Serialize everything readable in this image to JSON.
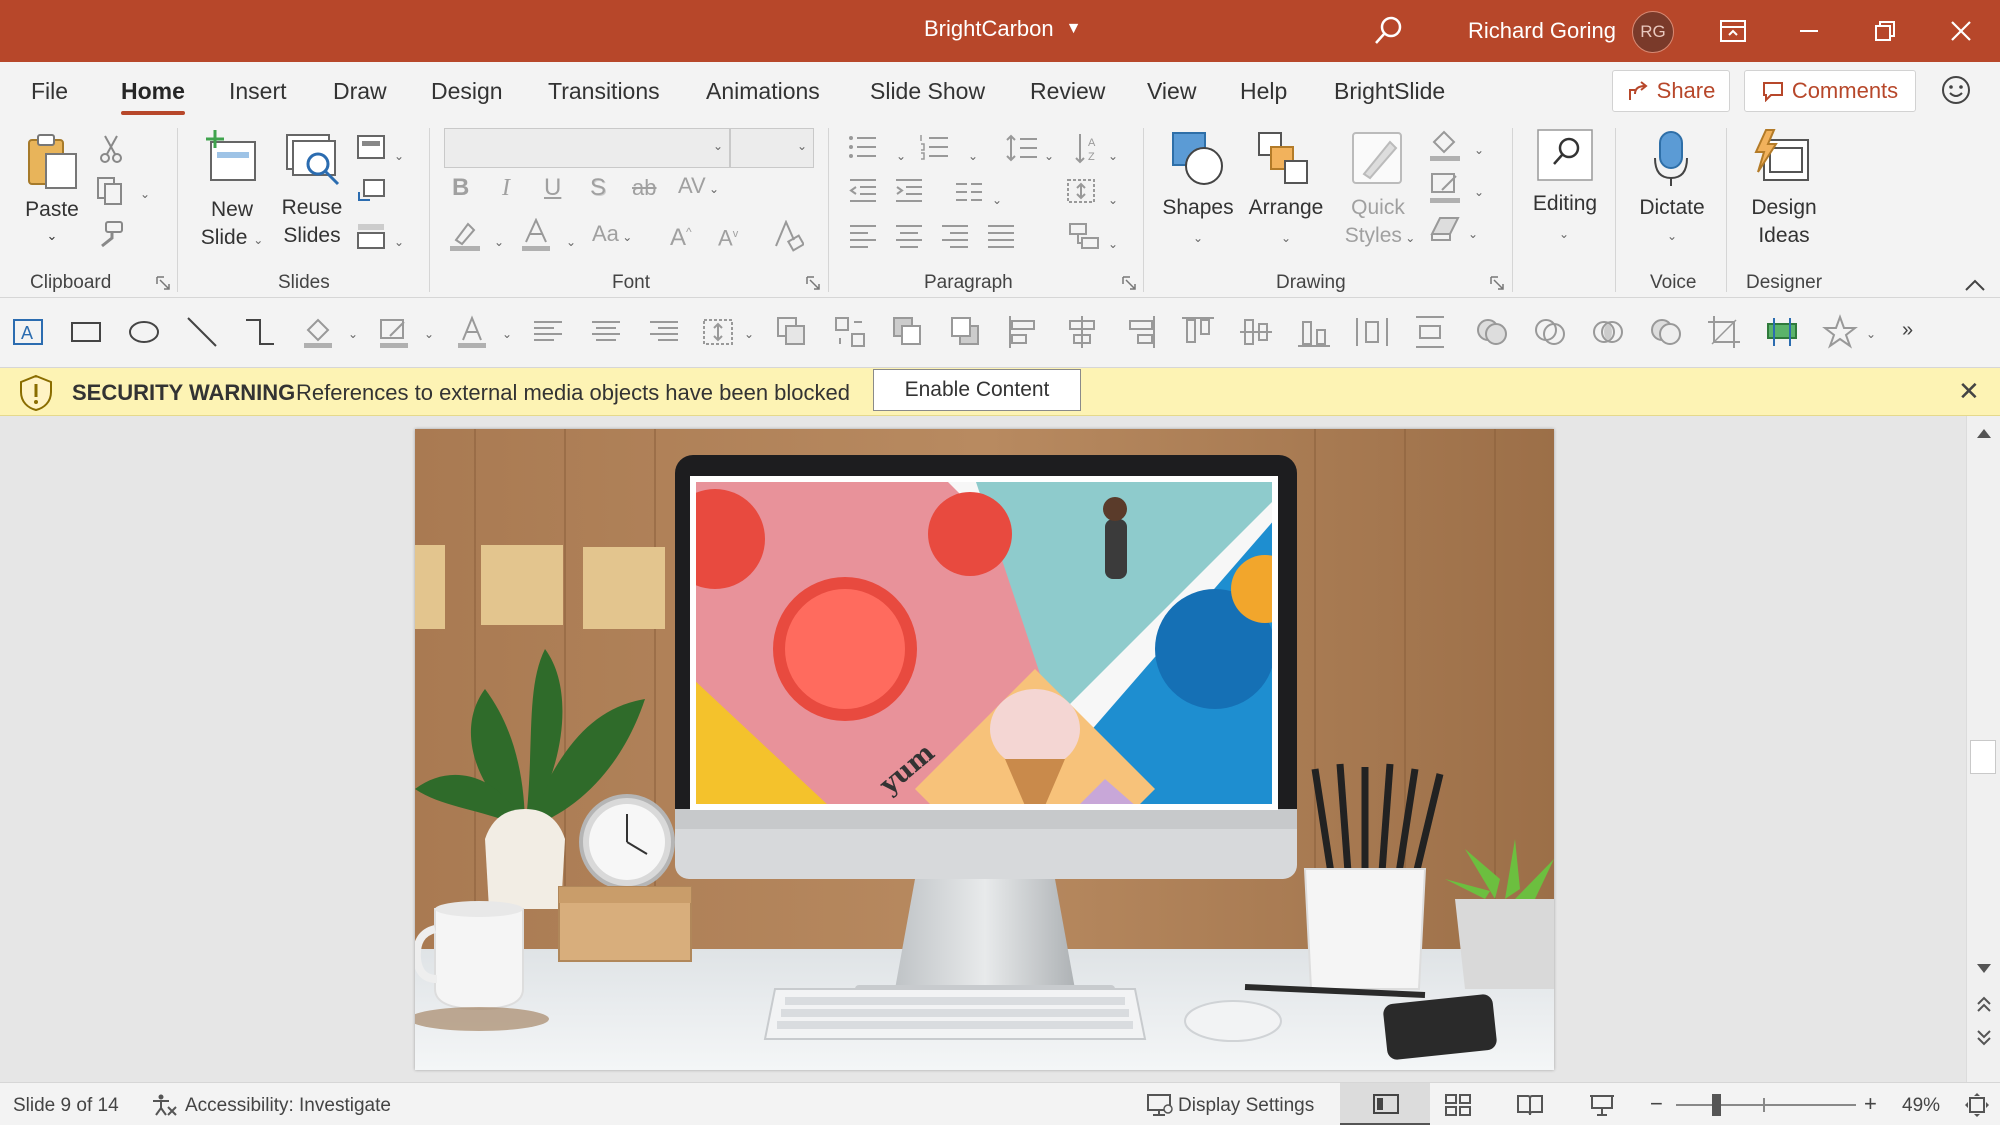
{
  "app": {
    "doc_title": "BrightCarbon",
    "user_name": "Richard Goring",
    "user_initials": "RG"
  },
  "tabs": [
    "File",
    "Home",
    "Insert",
    "Draw",
    "Design",
    "Transitions",
    "Animations",
    "Slide Show",
    "Review",
    "View",
    "Help",
    "BrightSlide"
  ],
  "actions": {
    "share": "Share",
    "comments": "Comments"
  },
  "ribbon": {
    "clipboard": {
      "label": "Clipboard",
      "paste": "Paste"
    },
    "slides": {
      "label": "Slides",
      "new_slide_1": "New",
      "new_slide_2": "Slide",
      "reuse_1": "Reuse",
      "reuse_2": "Slides"
    },
    "font": {
      "label": "Font",
      "bold": "B",
      "italic": "I",
      "underline": "U",
      "shadow": "S",
      "strike": "ab",
      "spacing": "AV",
      "case": "Aa",
      "grow": "A",
      "shrink": "A"
    },
    "paragraph": {
      "label": "Paragraph"
    },
    "drawing": {
      "label": "Drawing",
      "shapes": "Shapes",
      "arrange": "Arrange",
      "quick_1": "Quick",
      "quick_2": "Styles"
    },
    "editing": {
      "label": "Editing"
    },
    "voice": {
      "label": "Voice",
      "dictate": "Dictate"
    },
    "designer": {
      "label": "Designer",
      "ideas_1": "Design",
      "ideas_2": "Ideas"
    }
  },
  "security": {
    "title": "SECURITY WARNING",
    "message": "References to external media objects have been blocked",
    "button": "Enable Content"
  },
  "slide": {
    "screen_word": "yum"
  },
  "status": {
    "slide_counter": "Slide 9 of 14",
    "accessibility": "Accessibility: Investigate",
    "display_settings": "Display Settings",
    "zoom": "49%"
  },
  "colors": {
    "accent": "#b7472a",
    "warning_bg": "#fdf3b4",
    "ribbon_bg": "#f3f3f3"
  }
}
